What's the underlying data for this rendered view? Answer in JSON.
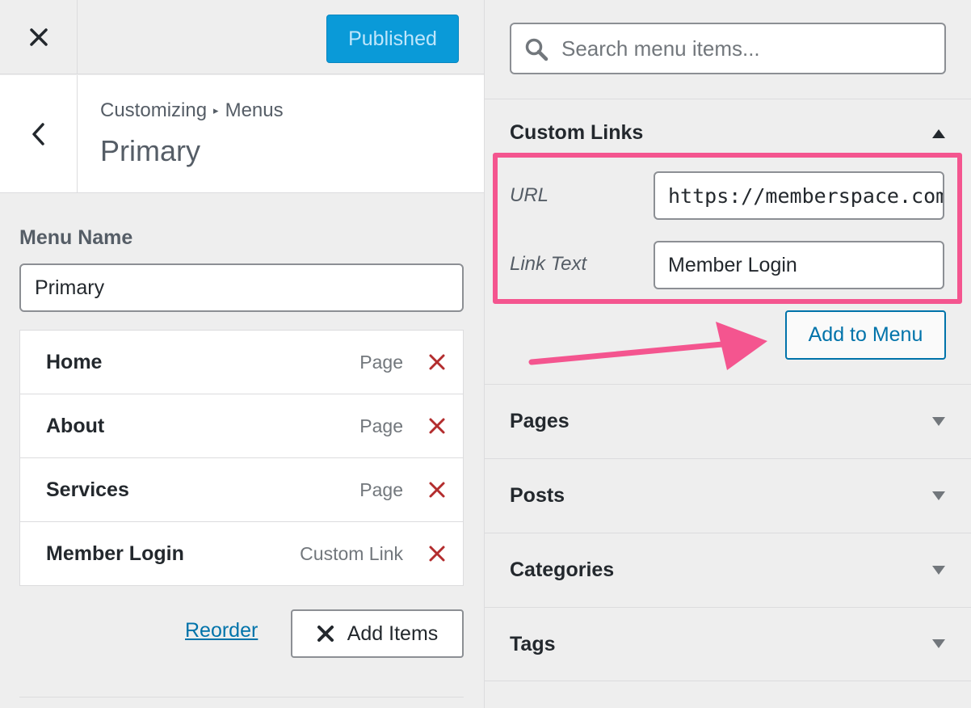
{
  "left_panel": {
    "publish_label": "Published",
    "breadcrumb": {
      "root": "Customizing",
      "separator": "▸",
      "current": "Menus"
    },
    "page_title": "Primary",
    "menu_name": {
      "label": "Menu Name",
      "value": "Primary"
    },
    "menu_items": [
      {
        "title": "Home",
        "type": "Page"
      },
      {
        "title": "About",
        "type": "Page"
      },
      {
        "title": "Services",
        "type": "Page"
      },
      {
        "title": "Member Login",
        "type": "Custom Link"
      }
    ],
    "reorder_label": "Reorder",
    "add_items_label": "Add Items"
  },
  "right_panel": {
    "search_placeholder": "Search menu items...",
    "custom_links": {
      "title": "Custom Links",
      "url_label": "URL",
      "url_value": "https://memberspace.com",
      "link_text_label": "Link Text",
      "link_text_value": "Member Login",
      "add_button_label": "Add to Menu"
    },
    "sections": [
      {
        "title": "Pages"
      },
      {
        "title": "Posts"
      },
      {
        "title": "Categories"
      },
      {
        "title": "Tags"
      }
    ]
  },
  "colors": {
    "primary_blue": "#0a9ad8",
    "link_blue": "#0073aa",
    "highlight_pink": "#f4558f",
    "delete_red": "#b32d2e"
  }
}
